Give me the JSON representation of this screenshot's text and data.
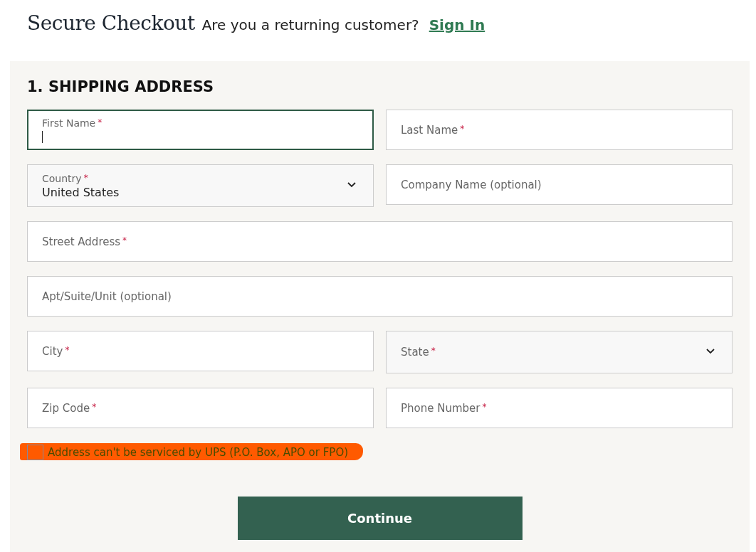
{
  "header": {
    "title": "Secure Checkout",
    "prompt": "Are you a returning customer?",
    "link": "Sign In"
  },
  "section": {
    "title": "1. SHIPPING ADDRESS"
  },
  "fields": [
    {
      "kind": "text",
      "label": "First Name",
      "required_mark": "*",
      "focused": true,
      "wide": false
    },
    {
      "kind": "text",
      "label": "Last Name",
      "required_mark": "*",
      "focused": false,
      "wide": false
    },
    {
      "kind": "select",
      "label": "Country",
      "required_mark": "*",
      "focused": false,
      "wide": false,
      "value": "United States"
    },
    {
      "kind": "text",
      "label": "Company Name (optional)",
      "focused": false,
      "wide": false
    },
    {
      "kind": "text",
      "label": "Street Address",
      "required_mark": "*",
      "focused": false,
      "wide": true
    },
    {
      "kind": "text",
      "label": "Apt/Suite/Unit (optional)",
      "focused": false,
      "wide": true
    },
    {
      "kind": "text",
      "label": "City",
      "required_mark": "*",
      "focused": false,
      "wide": false
    },
    {
      "kind": "select",
      "label": "State",
      "required_mark": "*",
      "focused": false,
      "wide": false
    },
    {
      "kind": "text",
      "label": "Zip Code",
      "required_mark": "*",
      "focused": false,
      "wide": false
    },
    {
      "kind": "text",
      "label": "Phone Number",
      "required_mark": "*",
      "focused": false,
      "wide": false
    }
  ],
  "checkbox": {
    "label": "Address can't be serviced by UPS (P.O. Box, APO or FPO)",
    "checked": false,
    "highlighted": true
  },
  "buttons": [
    "Continue"
  ]
}
